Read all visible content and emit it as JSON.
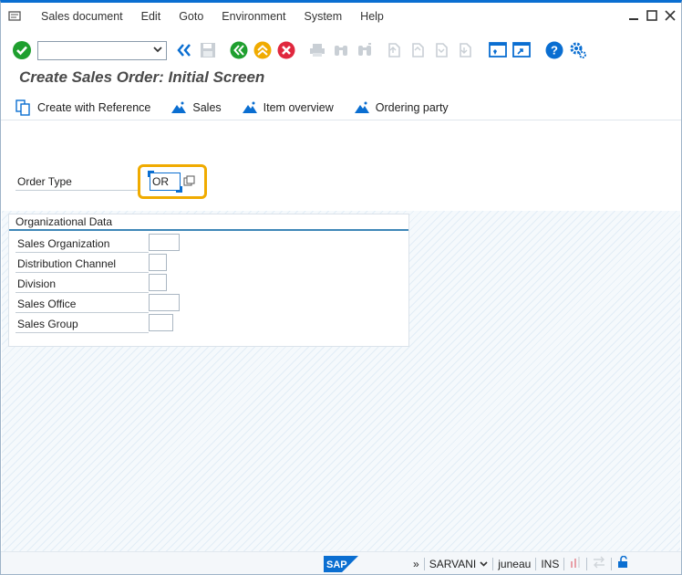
{
  "menubar": {
    "items": [
      {
        "label": "Sales document"
      },
      {
        "label": "Edit"
      },
      {
        "label": "Goto"
      },
      {
        "label": "Environment"
      },
      {
        "label": "System"
      },
      {
        "label": "Help"
      }
    ]
  },
  "toolbar": {
    "command_field_value": ""
  },
  "page_title": "Create Sales Order: Initial Screen",
  "app_toolbar": {
    "create_with_reference": "Create with Reference",
    "sales": "Sales",
    "item_overview": "Item overview",
    "ordering_party": "Ordering party"
  },
  "order_type": {
    "label": "Order Type",
    "value": "OR"
  },
  "org_data": {
    "title": "Organizational Data",
    "fields": [
      {
        "label": "Sales Organization",
        "value": ""
      },
      {
        "label": "Distribution Channel",
        "value": ""
      },
      {
        "label": "Division",
        "value": ""
      },
      {
        "label": "Sales Office",
        "value": ""
      },
      {
        "label": "Sales Group",
        "value": ""
      }
    ]
  },
  "statusbar": {
    "logo_text": "SAP",
    "expand": "»",
    "system": "SARVANI",
    "client": "juneau",
    "mode": "INS"
  },
  "colors": {
    "brand_blue": "#0a6ed1",
    "green": "#1f9f2f",
    "orange": "#f0ab00",
    "red": "#e0283e"
  }
}
